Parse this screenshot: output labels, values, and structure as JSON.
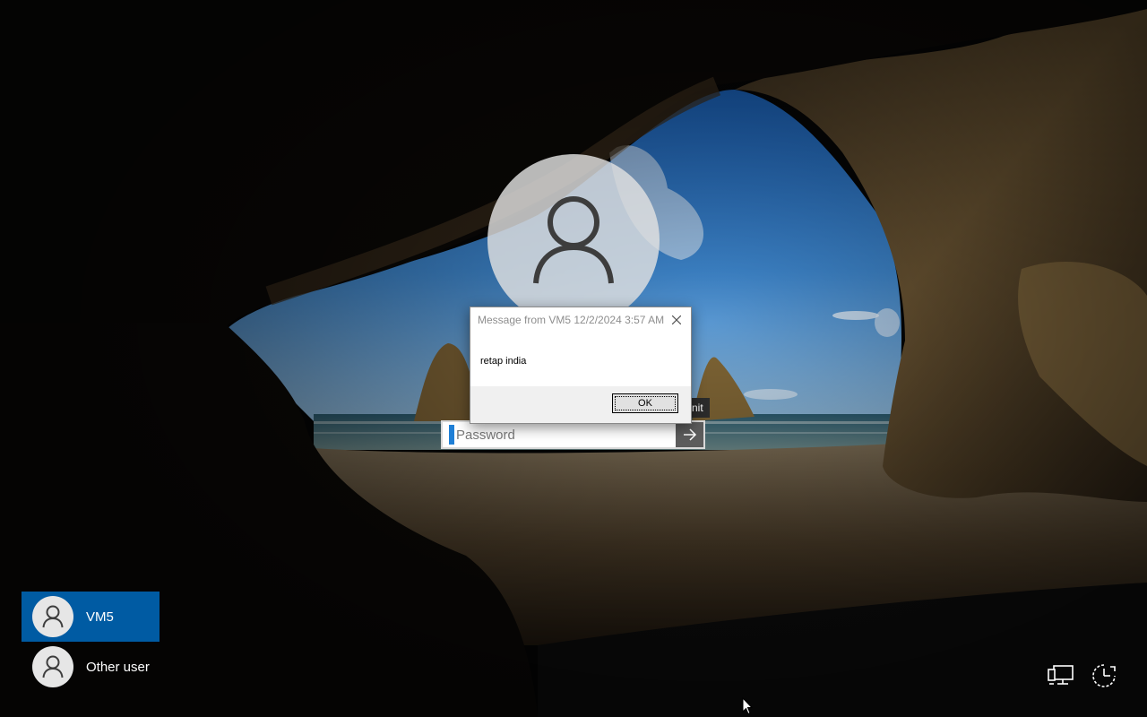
{
  "lock_screen": {
    "big_avatar_icon": "user-icon",
    "password_placeholder": "Password",
    "submit_icon": "arrow-right-icon",
    "tooltip_fragment": "nit"
  },
  "dialog": {
    "title": "Message from VM5 12/2/2024 3:57 AM",
    "message": "retap india",
    "ok_label": "OK",
    "close_icon": "close-icon"
  },
  "users": [
    {
      "name": "VM5",
      "selected": true,
      "icon": "user-icon"
    },
    {
      "name": "Other user",
      "selected": false,
      "icon": "user-icon"
    }
  ],
  "system_icons": {
    "network": "network-icon",
    "power": "ease-of-access-icon"
  },
  "colors": {
    "selected_user_bg": "#0063b1",
    "submit_button_bg": "#5c5c5c",
    "caret": "#1f7fd6"
  }
}
